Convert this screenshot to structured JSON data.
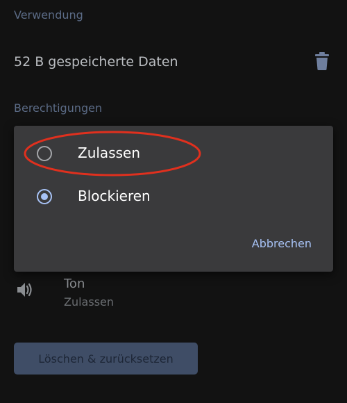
{
  "usage": {
    "header": "Verwendung",
    "stored_data": "52 B gespeicherte Daten",
    "delete_icon": "trash-icon"
  },
  "permissions": {
    "header": "Berechtigungen",
    "sound": {
      "icon": "speaker-icon",
      "title": "Ton",
      "value": "Zulassen"
    }
  },
  "reset_button": "Löschen & zurücksetzen",
  "dialog": {
    "options": [
      {
        "label": "Zulassen",
        "selected": false
      },
      {
        "label": "Blockieren",
        "selected": true
      }
    ],
    "cancel_label": "Abbrechen"
  },
  "colors": {
    "background": "#121212",
    "dialog_bg": "#3a3a3c",
    "accent": "#a7c2f5",
    "annotation": "#e0301e"
  }
}
